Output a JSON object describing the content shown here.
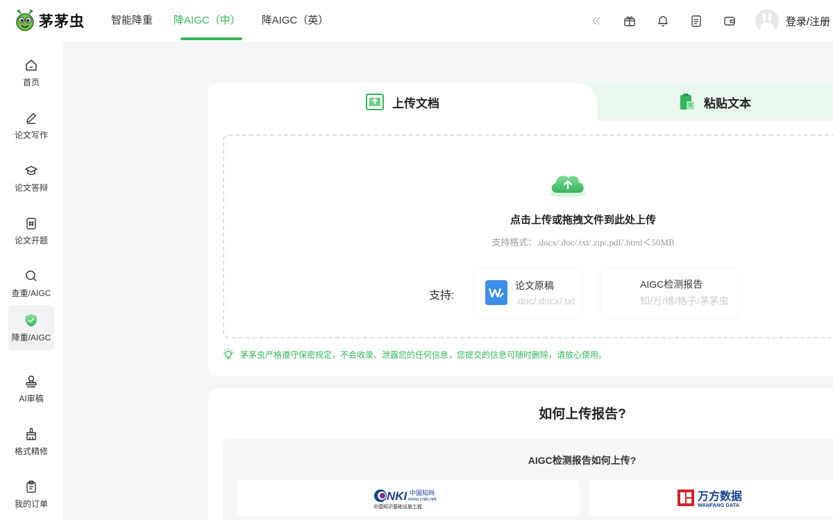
{
  "app": {
    "logo_text": "茅茅虫"
  },
  "nav": {
    "items": [
      {
        "label": "智能降重"
      },
      {
        "label": "降AIGC（中）",
        "active": true
      },
      {
        "label": "降AIGC（英）"
      }
    ]
  },
  "header": {
    "login_label": "登录/注册"
  },
  "sidebar": {
    "items": [
      {
        "label": "首页",
        "icon": "home-icon"
      },
      {
        "label": "论文写作",
        "icon": "pencil-icon"
      },
      {
        "label": "论文答辩",
        "icon": "graduation-cap-icon"
      },
      {
        "label": "论文开题",
        "icon": "hash-document-icon"
      },
      {
        "label": "查重/AIGC",
        "icon": "search-icon"
      },
      {
        "label": "降重/AIGC",
        "icon": "shield-icon",
        "active": true
      },
      {
        "label": "AI审稿",
        "icon": "stamp-icon"
      },
      {
        "label": "格式精修",
        "icon": "brush-icon"
      },
      {
        "label": "我的订单",
        "icon": "clipboard-icon"
      }
    ]
  },
  "upload": {
    "tabs": [
      {
        "label": "上传文档",
        "active": true
      },
      {
        "label": "粘贴文本"
      }
    ],
    "title": "点击上传或拖拽文件到此处上传",
    "formats": "支持格式：.docx/.doc/.txt/.zip/.pdf/.html＜50MB",
    "support_label": "支持:",
    "support_cards": [
      {
        "title": "论文原稿",
        "sub": ".doc/.docx/.txt"
      },
      {
        "title": "AIGC检测报告",
        "sub": "知/万/维/格子/茅茅虫"
      }
    ],
    "notice": "茅茅虫严格遵守保密规定，不会收录、泄露您的任何信息，您提交的信息可随时删除，请放心使用。"
  },
  "howto": {
    "title": "如何上传报告?",
    "subtitle": "AIGC检测报告如何上传?",
    "brands": [
      {
        "name": "CNKI",
        "line1": "中国知网",
        "url": "www.cnki.net",
        "line2": "中国知识基础设施工程"
      },
      {
        "name": "万方数据",
        "sub": "WANFANG DATA"
      }
    ]
  },
  "colors": {
    "accent": "#35b55a",
    "accent_light": "#e9f7ee",
    "wanfang_red": "#d6212a",
    "cnki_blue": "#1a3f8f"
  }
}
